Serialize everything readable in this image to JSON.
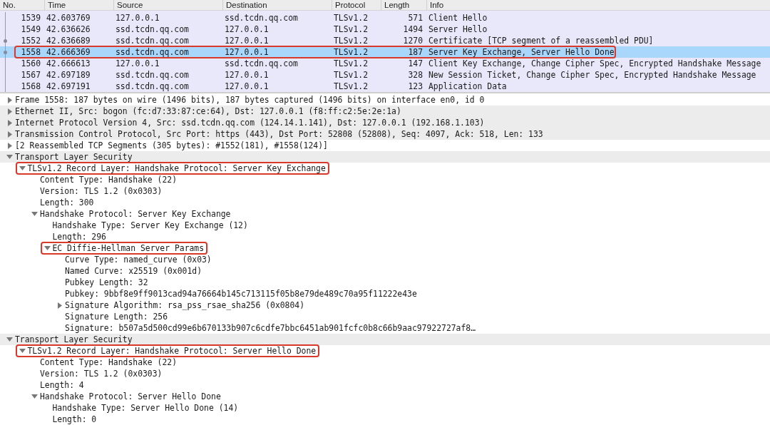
{
  "packet_list": {
    "columns": [
      "No.",
      "Time",
      "Source",
      "Destination",
      "Protocol",
      "Length",
      "Info"
    ],
    "rows": [
      {
        "cells": [
          "1539",
          "42.603769",
          "127.0.0.1",
          "ssd.tcdn.qq.com",
          "TLSv1.2",
          "571",
          "Client Hello"
        ],
        "selected": false,
        "related": false,
        "outlined": false
      },
      {
        "cells": [
          "1549",
          "42.636626",
          "ssd.tcdn.qq.com",
          "127.0.0.1",
          "TLSv1.2",
          "1494",
          "Server Hello"
        ],
        "selected": false,
        "related": false,
        "outlined": false
      },
      {
        "cells": [
          "1552",
          "42.636689",
          "ssd.tcdn.qq.com",
          "127.0.0.1",
          "TLSv1.2",
          "1270",
          "Certificate [TCP segment of a reassembled PDU]"
        ],
        "selected": false,
        "related": true,
        "outlined": false
      },
      {
        "cells": [
          "1558",
          "42.666369",
          "ssd.tcdn.qq.com",
          "127.0.0.1",
          "TLSv1.2",
          "187",
          "Server Key Exchange, Server Hello Done"
        ],
        "selected": true,
        "related": true,
        "outlined": true
      },
      {
        "cells": [
          "1560",
          "42.666613",
          "127.0.0.1",
          "ssd.tcdn.qq.com",
          "TLSv1.2",
          "147",
          "Client Key Exchange, Change Cipher Spec, Encrypted Handshake Message"
        ],
        "selected": false,
        "related": false,
        "outlined": false
      },
      {
        "cells": [
          "1567",
          "42.697189",
          "ssd.tcdn.qq.com",
          "127.0.0.1",
          "TLSv1.2",
          "328",
          "New Session Ticket, Change Cipher Spec, Encrypted Handshake Message"
        ],
        "selected": false,
        "related": false,
        "outlined": false
      },
      {
        "cells": [
          "1568",
          "42.697191",
          "ssd.tcdn.qq.com",
          "127.0.0.1",
          "TLSv1.2",
          "123",
          "Application Data"
        ],
        "selected": false,
        "related": false,
        "outlined": false
      }
    ]
  },
  "packet_details": [
    {
      "label": "Frame 1558: 187 bytes on wire (1496 bits), 187 bytes captured (1496 bits) on interface en0, id 0",
      "kind": "branch",
      "expanded": false,
      "shaded": false,
      "outlined": false
    },
    {
      "label": "Ethernet II, Src: bogon (fc:d7:33:87:ce:64), Dst: 127.0.0.1 (f8:ff:c2:5e:2e:1a)",
      "kind": "branch",
      "expanded": false,
      "shaded": true,
      "outlined": false
    },
    {
      "label": "Internet Protocol Version 4, Src: ssd.tcdn.qq.com (124.14.1.141), Dst: 127.0.0.1 (192.168.1.103)",
      "kind": "branch",
      "expanded": false,
      "shaded": true,
      "outlined": false
    },
    {
      "label": "Transmission Control Protocol, Src Port: https (443), Dst Port: 52808 (52808), Seq: 4097, Ack: 518, Len: 133",
      "kind": "branch",
      "expanded": false,
      "shaded": true,
      "outlined": false
    },
    {
      "label": "[2 Reassembled TCP Segments (305 bytes): #1552(181), #1558(124)]",
      "kind": "branch",
      "expanded": false,
      "shaded": false,
      "outlined": false
    },
    {
      "label": "Transport Layer Security",
      "kind": "branch",
      "expanded": true,
      "shaded": true,
      "outlined": false,
      "children": [
        {
          "label": "TLSv1.2 Record Layer: Handshake Protocol: Server Key Exchange",
          "kind": "branch",
          "expanded": true,
          "shaded": false,
          "outlined": true,
          "children": [
            {
              "label": "Content Type: Handshake (22)",
              "kind": "leaf",
              "shaded": false,
              "outlined": false
            },
            {
              "label": "Version: TLS 1.2 (0x0303)",
              "kind": "leaf",
              "shaded": false,
              "outlined": false
            },
            {
              "label": "Length: 300",
              "kind": "leaf",
              "shaded": false,
              "outlined": false
            },
            {
              "label": "Handshake Protocol: Server Key Exchange",
              "kind": "branch",
              "expanded": true,
              "shaded": false,
              "outlined": false,
              "children": [
                {
                  "label": "Handshake Type: Server Key Exchange (12)",
                  "kind": "leaf",
                  "shaded": false,
                  "outlined": false
                },
                {
                  "label": "Length: 296",
                  "kind": "leaf",
                  "shaded": false,
                  "outlined": false
                },
                {
                  "label": "EC Diffie-Hellman Server Params",
                  "kind": "branch",
                  "expanded": true,
                  "shaded": false,
                  "outlined": true,
                  "children": [
                    {
                      "label": "Curve Type: named_curve (0x03)",
                      "kind": "leaf",
                      "shaded": false,
                      "outlined": false
                    },
                    {
                      "label": "Named Curve: x25519 (0x001d)",
                      "kind": "leaf",
                      "shaded": false,
                      "outlined": false
                    },
                    {
                      "label": "Pubkey Length: 32",
                      "kind": "leaf",
                      "shaded": false,
                      "outlined": false
                    },
                    {
                      "label": "Pubkey: 9bbf8e9ff9013cad94a76664b145c713115f05b8e79de489c70a95f11222e43e",
                      "kind": "leaf",
                      "shaded": false,
                      "outlined": false
                    },
                    {
                      "label": "Signature Algorithm: rsa_pss_rsae_sha256 (0x0804)",
                      "kind": "branch",
                      "expanded": false,
                      "shaded": false,
                      "outlined": false
                    },
                    {
                      "label": "Signature Length: 256",
                      "kind": "leaf",
                      "shaded": false,
                      "outlined": false
                    },
                    {
                      "label": "Signature: b507a5d500cd99e6b670133b907c6cdfe7bbc6451ab901fcfc0b8c66b9aac97922727af8…",
                      "kind": "leaf",
                      "shaded": false,
                      "outlined": false
                    }
                  ]
                }
              ]
            }
          ]
        }
      ]
    },
    {
      "label": "Transport Layer Security",
      "kind": "branch",
      "expanded": true,
      "shaded": true,
      "outlined": false,
      "children": [
        {
          "label": "TLSv1.2 Record Layer: Handshake Protocol: Server Hello Done",
          "kind": "branch",
          "expanded": true,
          "shaded": false,
          "outlined": true,
          "children": [
            {
              "label": "Content Type: Handshake (22)",
              "kind": "leaf",
              "shaded": false,
              "outlined": false
            },
            {
              "label": "Version: TLS 1.2 (0x0303)",
              "kind": "leaf",
              "shaded": false,
              "outlined": false
            },
            {
              "label": "Length: 4",
              "kind": "leaf",
              "shaded": false,
              "outlined": false
            },
            {
              "label": "Handshake Protocol: Server Hello Done",
              "kind": "branch",
              "expanded": true,
              "shaded": false,
              "outlined": false,
              "children": [
                {
                  "label": "Handshake Type: Server Hello Done (14)",
                  "kind": "leaf",
                  "shaded": false,
                  "outlined": false
                },
                {
                  "label": "Length: 0",
                  "kind": "leaf",
                  "shaded": false,
                  "outlined": false
                }
              ]
            }
          ]
        }
      ]
    }
  ]
}
